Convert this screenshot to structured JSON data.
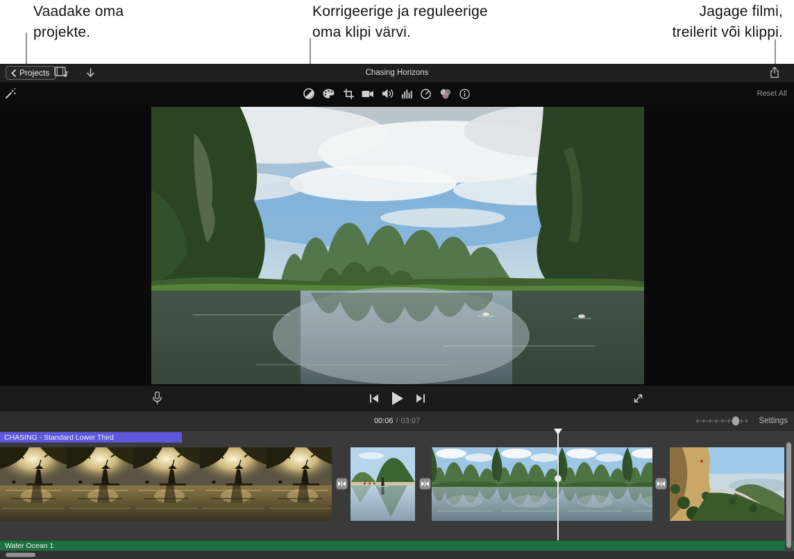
{
  "callouts": {
    "left": {
      "line1": "Vaadake oma",
      "line2": "projekte."
    },
    "center": {
      "line1": "Korrigeerige ja reguleerige",
      "line2": "oma klipi värvi."
    },
    "right": {
      "line1": "Jagage filmi,",
      "line2": "treilerit või klippi."
    }
  },
  "window": {
    "toolbar": {
      "projects": "Projects",
      "title": "Chasing Horizons"
    },
    "adjust": {
      "reset_all": "Reset All"
    },
    "player": {
      "current_time": "00:06",
      "separator": "/",
      "total_time": "03:07",
      "settings": "Settings"
    },
    "timeline": {
      "title_bar": "CHASING - Standard Lower Third",
      "audio_bar": "Water Ocean 1"
    }
  },
  "icons": {
    "toolbar": [
      "back-chevron-icon",
      "media-library-icon",
      "import-arrow-icon",
      "share-icon"
    ],
    "adjust_bar": [
      "auto-enhance-wand-icon",
      "color-balance-icon",
      "color-palette-icon",
      "crop-icon",
      "stabilization-camera-icon",
      "volume-icon",
      "noise-equalizer-icon",
      "speed-gauge-icon",
      "clip-filter-icon",
      "info-icon"
    ],
    "player": [
      "microphone-icon",
      "skip-back-icon",
      "play-icon",
      "skip-forward-icon",
      "fullscreen-icon"
    ],
    "timeline": [
      "transition-icon",
      "playhead"
    ]
  },
  "colors": {
    "title_clip_purple": "#5b58dd",
    "audio_clip_green": "#1e7040",
    "callout_line_gray": "#919191",
    "toolbar_bg": "#1f1f1f",
    "timeline_bg": "#3a3a3a"
  }
}
